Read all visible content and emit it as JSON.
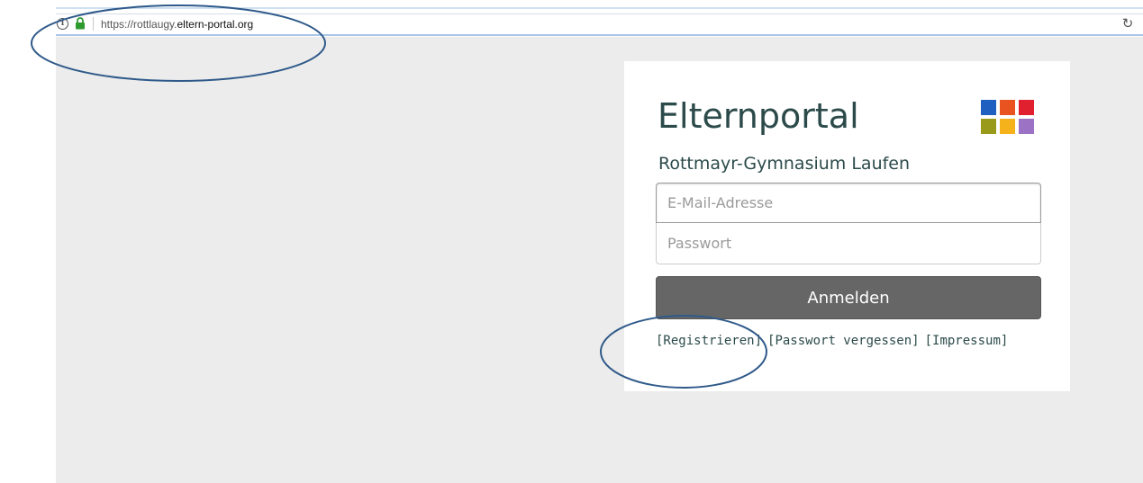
{
  "browser": {
    "url_prefix": "https://rottlaugy.",
    "url_domain": "eltern-portal.org",
    "info_icon": "info-icon",
    "info_glyph": "i",
    "lock_icon": "lock-icon",
    "reload_icon": "reload-icon"
  },
  "login": {
    "app_title": "Elternportal",
    "school_name": "Rottmayr-Gymnasium Laufen",
    "email_placeholder": "E-Mail-Adresse",
    "password_placeholder": "Passwort",
    "submit_label": "Anmelden",
    "links": {
      "register": "[Registrieren]",
      "forgot_password": "[Passwort vergessen]",
      "imprint": "[Impressum]"
    }
  },
  "logo_colors": [
    "#1f5fbf",
    "#e8531f",
    "#e0202e",
    "#9a9a1a",
    "#f5b21b",
    "#9b72c4"
  ],
  "colors": {
    "text": "#2c4a4a",
    "button": "#666666",
    "page_bg": "#ececec",
    "annotation": "#2f5a8a"
  }
}
